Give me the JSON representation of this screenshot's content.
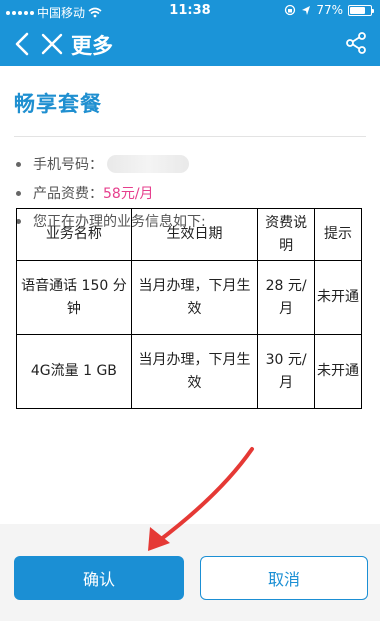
{
  "status_bar": {
    "carrier": "中国移动",
    "time": "11:38",
    "battery": "77%",
    "battery_level": 0.77
  },
  "nav": {
    "title": "更多",
    "back_icon": "chevron-left-icon",
    "close_icon": "close-icon",
    "share_icon": "share-icon"
  },
  "package": {
    "title": "畅享套餐",
    "phone_label": "手机号码：",
    "fee_label": "产品资费：",
    "fee_value": "58元/月",
    "info_label": "您正在办理的业务信息如下:"
  },
  "table": {
    "headers": [
      "业务名称",
      "生效日期",
      "资费说明",
      "提示"
    ],
    "rows": [
      [
        "语音通话 150 分钟",
        "当月办理，下月生效",
        "28 元/月",
        "未开通"
      ],
      [
        "4G流量 1 GB",
        "当月办理，下月生效",
        "30 元/月",
        "未开通"
      ]
    ]
  },
  "buttons": {
    "confirm": "确认",
    "cancel": "取消"
  },
  "colors": {
    "brand_blue": "#1b94d8",
    "price_pink": "#e63f8d",
    "arrow_red": "#e53935"
  }
}
